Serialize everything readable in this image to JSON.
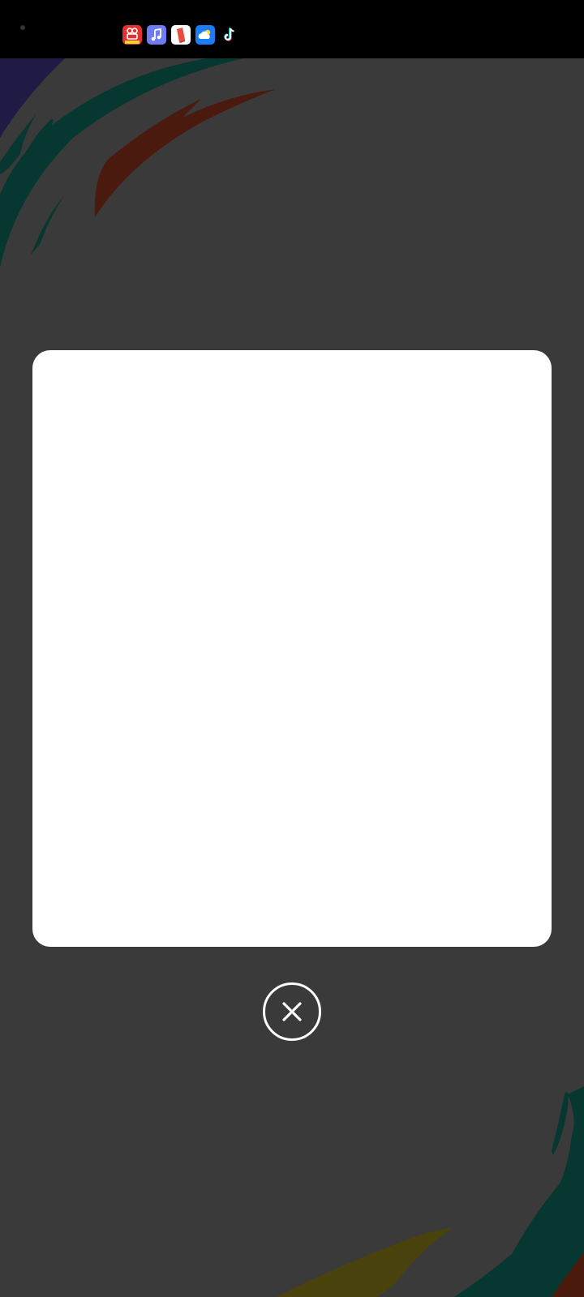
{
  "status_bar": {
    "notification_icons": [
      {
        "name": "kuaishou-app-icon",
        "color": "#e0322e"
      },
      {
        "name": "music-app-icon",
        "color": "#6f7bf2"
      },
      {
        "name": "reader-app-icon",
        "color": "#ffffff"
      },
      {
        "name": "weather-app-icon",
        "color": "#1b7df5"
      },
      {
        "name": "tiktok-app-icon",
        "color": "#000000"
      }
    ]
  },
  "colors": {
    "background": "#3a3a3a",
    "dialog": "#ffffff",
    "close_button": "#ffffff",
    "wallpaper_teal": "#063731",
    "wallpaper_rust": "#4a1a0e",
    "wallpaper_olive": "#4a420c",
    "wallpaper_indigo": "#201b45"
  },
  "dialog": {
    "close_icon": "close-icon"
  }
}
